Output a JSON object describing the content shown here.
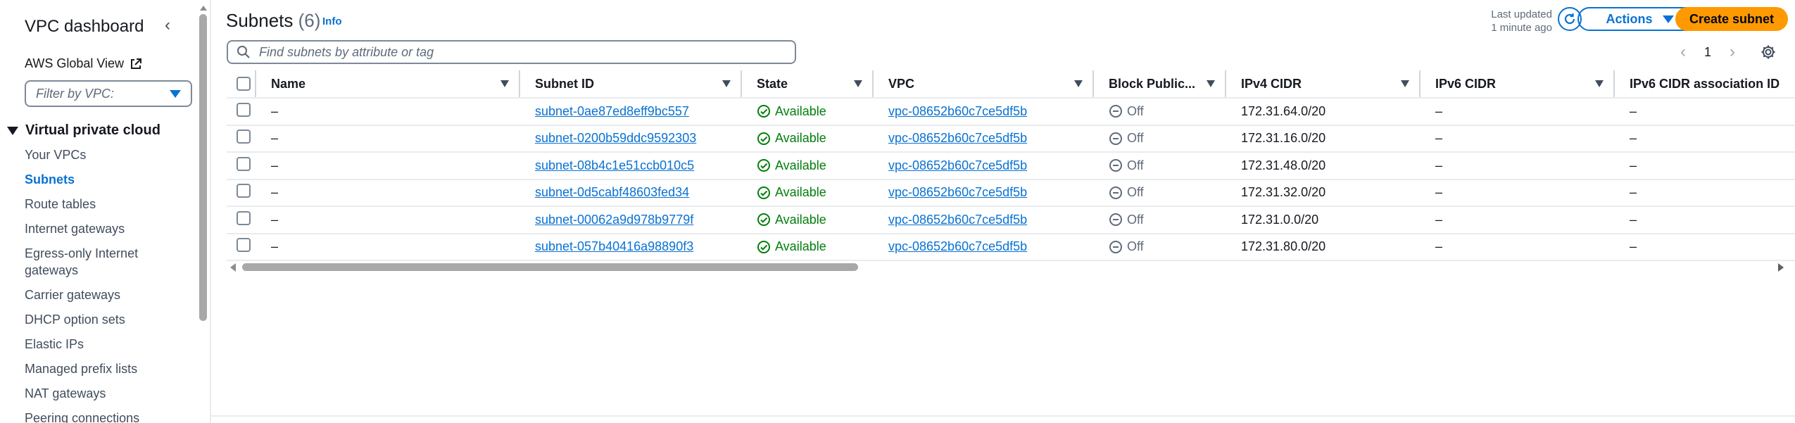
{
  "sidebar": {
    "title": "VPC dashboard",
    "global_view": "AWS Global View",
    "filter_placeholder": "Filter by VPC:",
    "section": "Virtual private cloud",
    "items": [
      {
        "label": "Your VPCs",
        "active": false
      },
      {
        "label": "Subnets",
        "active": true
      },
      {
        "label": "Route tables",
        "active": false
      },
      {
        "label": "Internet gateways",
        "active": false
      },
      {
        "label": "Egress-only Internet gateways",
        "active": false
      },
      {
        "label": "Carrier gateways",
        "active": false
      },
      {
        "label": "DHCP option sets",
        "active": false
      },
      {
        "label": "Elastic IPs",
        "active": false
      },
      {
        "label": "Managed prefix lists",
        "active": false
      },
      {
        "label": "NAT gateways",
        "active": false
      },
      {
        "label": "Peering connections",
        "active": false
      }
    ]
  },
  "header": {
    "title": "Subnets",
    "count": "(6)",
    "info": "Info",
    "last_updated_label": "Last updated",
    "last_updated_value": "1 minute ago",
    "actions_label": "Actions",
    "create_label": "Create subnet"
  },
  "search": {
    "placeholder": "Find subnets by attribute or tag"
  },
  "pagination": {
    "prev": "‹",
    "page": "1",
    "next": "›"
  },
  "table": {
    "columns": [
      "Name",
      "Subnet ID",
      "State",
      "VPC",
      "Block Public...",
      "IPv4 CIDR",
      "IPv6 CIDR",
      "IPv6 CIDR association ID"
    ],
    "rows": [
      {
        "name": "–",
        "subnet_id": "subnet-0ae87ed8eff9bc557",
        "state": "Available",
        "vpc": "vpc-08652b60c7ce5df5b",
        "block": "Off",
        "ipv4": "172.31.64.0/20",
        "ipv6": "–",
        "ipv6_assoc": "–"
      },
      {
        "name": "–",
        "subnet_id": "subnet-0200b59ddc9592303",
        "state": "Available",
        "vpc": "vpc-08652b60c7ce5df5b",
        "block": "Off",
        "ipv4": "172.31.16.0/20",
        "ipv6": "–",
        "ipv6_assoc": "–"
      },
      {
        "name": "–",
        "subnet_id": "subnet-08b4c1e51ccb010c5",
        "state": "Available",
        "vpc": "vpc-08652b60c7ce5df5b",
        "block": "Off",
        "ipv4": "172.31.48.0/20",
        "ipv6": "–",
        "ipv6_assoc": "–"
      },
      {
        "name": "–",
        "subnet_id": "subnet-0d5cabf48603fed34",
        "state": "Available",
        "vpc": "vpc-08652b60c7ce5df5b",
        "block": "Off",
        "ipv4": "172.31.32.0/20",
        "ipv6": "–",
        "ipv6_assoc": "–"
      },
      {
        "name": "–",
        "subnet_id": "subnet-00062a9d978b9779f",
        "state": "Available",
        "vpc": "vpc-08652b60c7ce5df5b",
        "block": "Off",
        "ipv4": "172.31.0.0/20",
        "ipv6": "–",
        "ipv6_assoc": "–"
      },
      {
        "name": "–",
        "subnet_id": "subnet-057b40416a98890f3",
        "state": "Available",
        "vpc": "vpc-08652b60c7ce5df5b",
        "block": "Off",
        "ipv4": "172.31.80.0/20",
        "ipv6": "–",
        "ipv6_assoc": "–"
      }
    ]
  },
  "colors": {
    "link": "#0972d3",
    "primary_button": "#ff9900",
    "available": "#037f0c",
    "muted": "#5f6b7a"
  }
}
